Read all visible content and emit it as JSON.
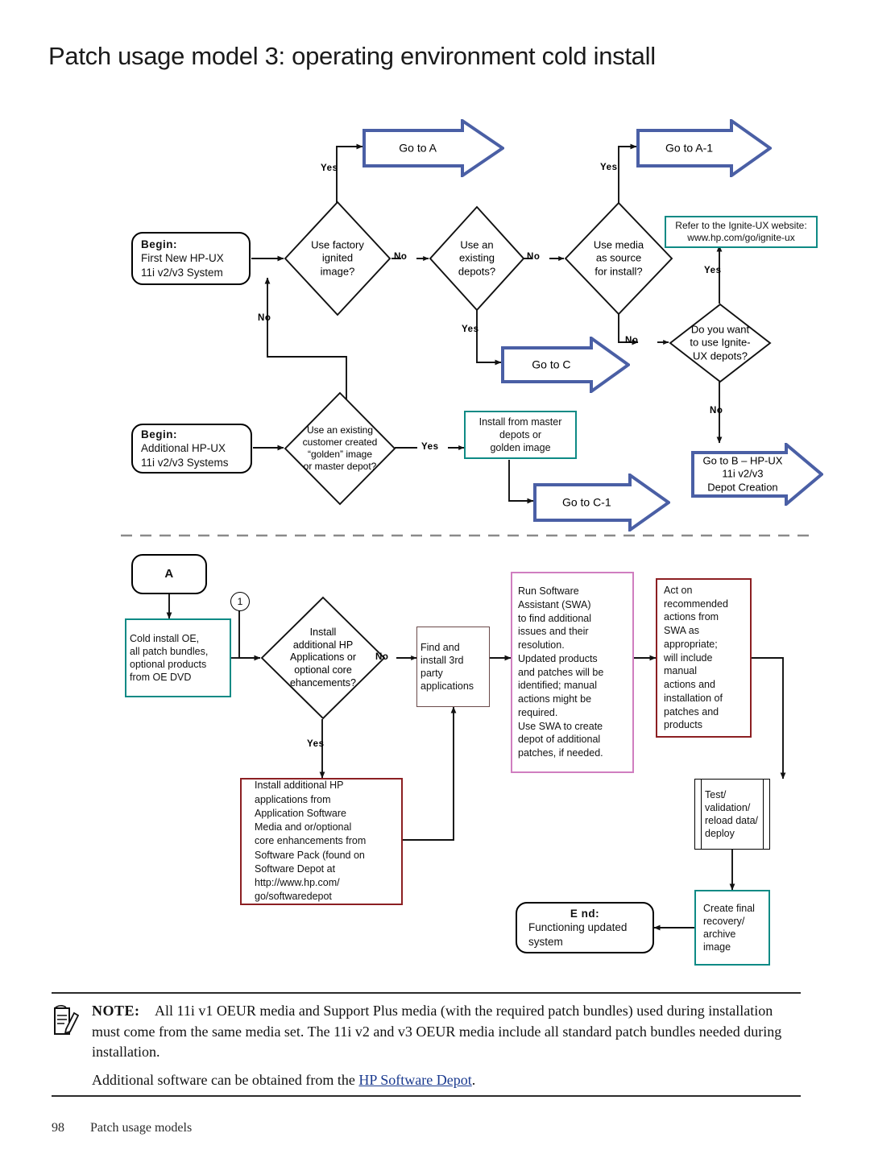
{
  "page_title": "Patch usage model 3: operating environment cold install",
  "flow_top": {
    "begin_first": "Begin:\nFirst New HP-UX\n11i v2/v3 System",
    "begin_first_label": "Begin:",
    "begin_first_l2": "First New HP-UX",
    "begin_first_l3": "11i v2/v3 System",
    "begin_additional_label": "Begin:",
    "begin_additional_l2": "Additional HP-UX",
    "begin_additional_l3": "11i v2/v3 Systems",
    "d_factory": "Use factory\nignited\nimage?",
    "d_depots": "Use an\nexisting\ndepots?",
    "d_media": "Use media\nas source\nfor install?",
    "d_ignite": "Do you want\nto use Ignite-\nUX depots?",
    "d_golden": "Use an existing\ncustomer created\n“golden” image\nor master depot?",
    "ignite_ref_l1": "Refer to the Ignite-UX website:",
    "ignite_ref_l2": "www.hp.com/go/ignite-ux",
    "install_master": "Install from master\ndepots or\ngolden image",
    "goto_a": "Go to A",
    "goto_a1": "Go to A-1",
    "goto_c": "Go to C",
    "goto_c1": "Go to C-1",
    "goto_b": "Go to B – HP-UX\n11i v2/v3\nDepot Creation",
    "yes": "Yes",
    "no": "No"
  },
  "flow_bottom": {
    "connector_a": "A",
    "step_num": "1",
    "cold_install": "Cold install OE,\nall patch bundles,\noptional products\nfrom OE DVD",
    "d_addhp": "Install\nadditional HP\nApplications or\noptional core\nehancements?",
    "find_3rd": "Find and\ninstall 3rd\nparty\napplications",
    "swa": "Run Software\nAssistant (SWA)\nto find additional\nissues and their\nresolution.\nUpdated products\nand patches will be\nidentified; manual\nactions might be\nrequired.\nUse SWA to create\ndepot of additional\npatches, if needed.",
    "act_on": "Act on\nrecommended\nactions from\nSWA as\nappropriate;\nwill include\nmanual\nactions and\ninstallation of\npatches and\nproducts",
    "install_add_hp": "Install additional HP\napplications from\nApplication Software\nMedia and or/optional\ncore enhancements from\nSoftware Pack (found on\nSoftware Depot at\nhttp://www.hp.com/\ngo/softwaredepot",
    "test_validate": "Test/\nvalidation/\nreload data/\ndeploy",
    "create_final": "Create final\nrecovery/\narchive\nimage",
    "end_label": "E nd:",
    "end_l2": "Functioning updated",
    "end_l3": "system",
    "yes": "Yes",
    "no": "No"
  },
  "note": {
    "label": "NOTE:",
    "p1": "All 11i v1 OEUR media and Support Plus media (with the required patch bundles) used during installation must come from the same media set. The 11i v2 and v3 OEUR media include all standard patch bundles needed during installation.",
    "p2_pre": "Additional software can be obtained from the ",
    "p2_link": "HP Software Depot",
    "p2_post": "."
  },
  "footer": {
    "page_number": "98",
    "section": "Patch usage models"
  },
  "colors": {
    "chevron_blue": "#4a5fa5",
    "teal": "#0e8a85",
    "dark_red": "#8c1f22",
    "pink": "#d07ec0",
    "link_blue": "#1a3a8f"
  }
}
